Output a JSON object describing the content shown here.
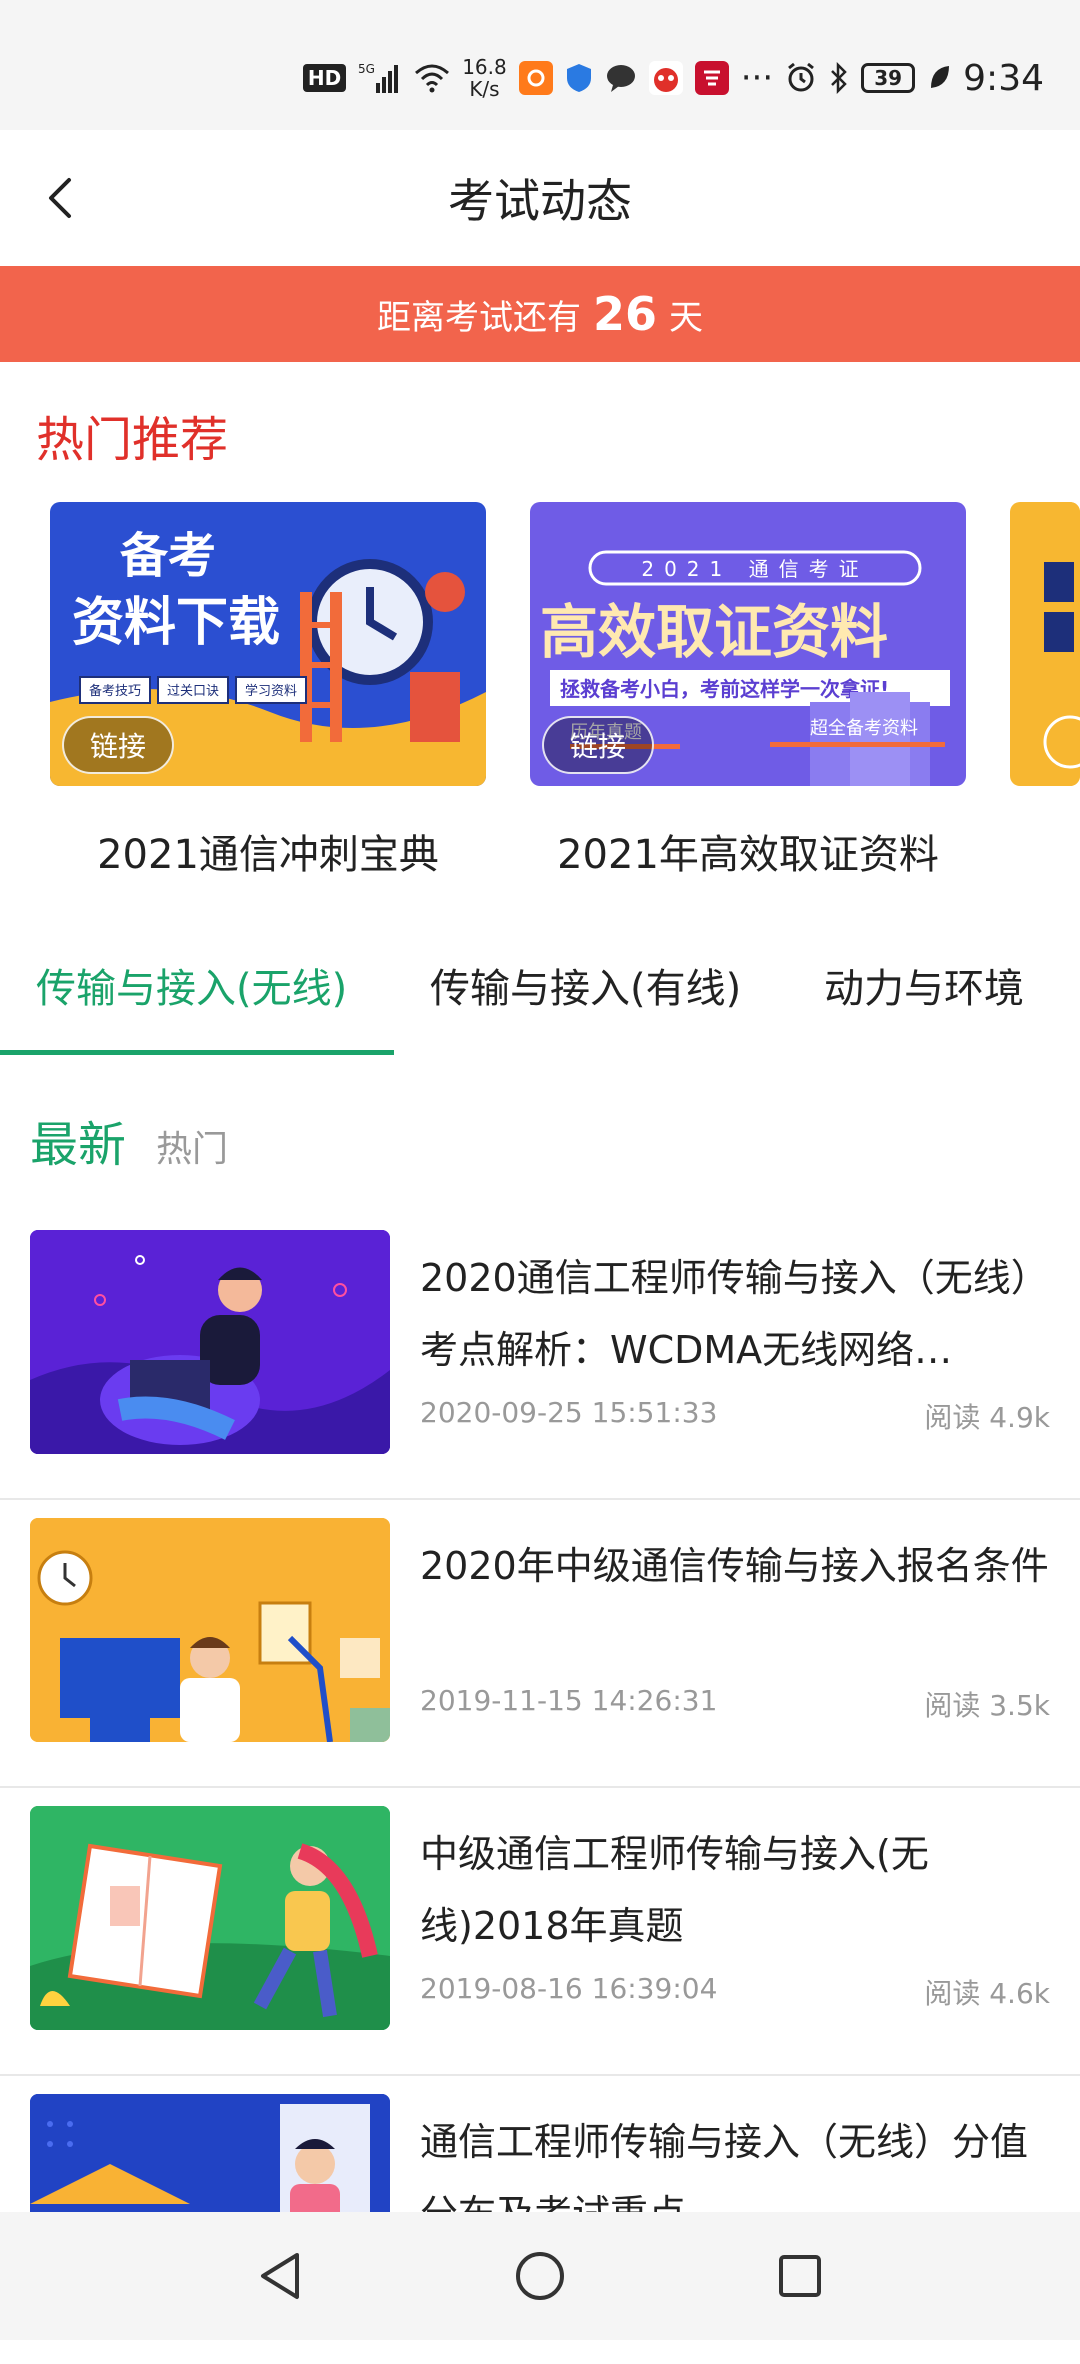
{
  "status_bar": {
    "network_badge": "HD",
    "signal_label": "5G",
    "speed_value": "16.8",
    "speed_unit": "K/s",
    "more": "···",
    "battery": "39",
    "time": "9:34"
  },
  "header": {
    "title": "考试动态",
    "back_icon": "chevron-left-icon"
  },
  "countdown": {
    "prefix": "距离考试还有",
    "days": "26",
    "suffix": "天",
    "color": "#f2644c"
  },
  "hot": {
    "title": "热门推荐",
    "banners": [
      {
        "label": "2021通信冲刺宝典",
        "tag": "链接",
        "art": {
          "line1": "备考",
          "line2": "资料下载",
          "chips": [
            "备考技巧",
            "过关口诀",
            "学习资料"
          ]
        }
      },
      {
        "label": "2021年高效取证资料",
        "tag": "链接",
        "art": {
          "pill": "2021 通信考证",
          "headline": "高效取证资料",
          "sub": "拯救备考小白，考前这样学一次拿证!",
          "left": "历年真题",
          "right": "超全备考资料"
        }
      }
    ]
  },
  "tabs": {
    "items": [
      "传输与接入(无线)",
      "传输与接入(有线)",
      "动力与环境"
    ],
    "active_color": "#1aa36a"
  },
  "filter": {
    "latest": "最新",
    "hot": "热门"
  },
  "articles": [
    {
      "title": "2020通信工程师传输与接入（无线）考点解析：WCDMA无线网络…",
      "date": "2020-09-25 15:51:33",
      "reads": "阅读 4.9k"
    },
    {
      "title": "2020年中级通信传输与接入报名条件",
      "date": "2019-11-15 14:26:31",
      "reads": "阅读 3.5k"
    },
    {
      "title": "中级通信工程师传输与接入(无线)2018年真题",
      "date": "2019-08-16 16:39:04",
      "reads": "阅读 4.6k"
    },
    {
      "title": "通信工程师传输与接入（无线）分值分布及考试重点",
      "date": "",
      "reads": ""
    }
  ],
  "nav_bar": {
    "back_icon": "triangle-back-icon",
    "home_icon": "circle-home-icon",
    "recents_icon": "square-recents-icon"
  }
}
